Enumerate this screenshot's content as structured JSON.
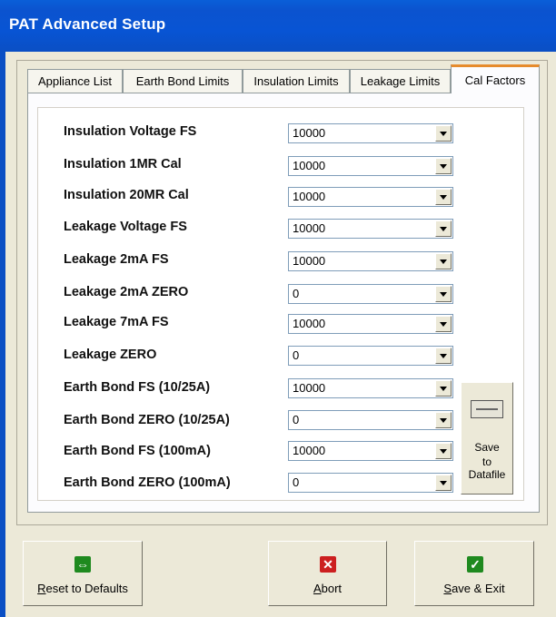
{
  "window": {
    "title": "PAT Advanced Setup"
  },
  "tabs": [
    {
      "label": "Appliance List",
      "active": false
    },
    {
      "label": "Earth Bond Limits",
      "active": false
    },
    {
      "label": "Insulation Limits",
      "active": false
    },
    {
      "label": "Leakage Limits",
      "active": false
    },
    {
      "label": "Cal Factors",
      "active": true
    }
  ],
  "cal_factors": [
    {
      "label": "Insulation Voltage FS",
      "value": "10000"
    },
    {
      "label": "Insulation 1MR Cal",
      "value": "10000"
    },
    {
      "label": "Insulation 20MR Cal",
      "value": "10000"
    },
    {
      "label": "Leakage Voltage FS",
      "value": "10000"
    },
    {
      "label": "Leakage 2mA FS",
      "value": "10000"
    },
    {
      "label": "Leakage 2mA ZERO",
      "value": "0"
    },
    {
      "label": "Leakage 7mA FS",
      "value": "10000"
    },
    {
      "label": "Leakage ZERO",
      "value": "0"
    },
    {
      "label": "Earth Bond FS (10/25A)",
      "value": "10000"
    },
    {
      "label": "Earth Bond ZERO (10/25A)",
      "value": "0"
    },
    {
      "label": "Earth Bond FS (100mA)",
      "value": "10000"
    },
    {
      "label": "Earth Bond ZERO (100mA)",
      "value": "0"
    }
  ],
  "save_datafile": {
    "line1": "Save",
    "line2": "to",
    "line3": "Datafile",
    "icon": "drive-icon"
  },
  "buttons": {
    "reset": {
      "mnemonic": "R",
      "rest": "eset to Defaults",
      "icon": "arrows-icon",
      "color": "#1f8a1f"
    },
    "abort": {
      "mnemonic": "A",
      "rest": "bort",
      "icon": "x-icon",
      "color": "#cc1f1f"
    },
    "save_exit": {
      "mnemonic": "S",
      "rest": "ave & Exit",
      "icon": "check-icon",
      "color": "#1f8a1f"
    }
  },
  "colors": {
    "titlebar": "#0a5fd8",
    "active_tab_accent": "#e68b2c",
    "background": "#ece9d8"
  }
}
